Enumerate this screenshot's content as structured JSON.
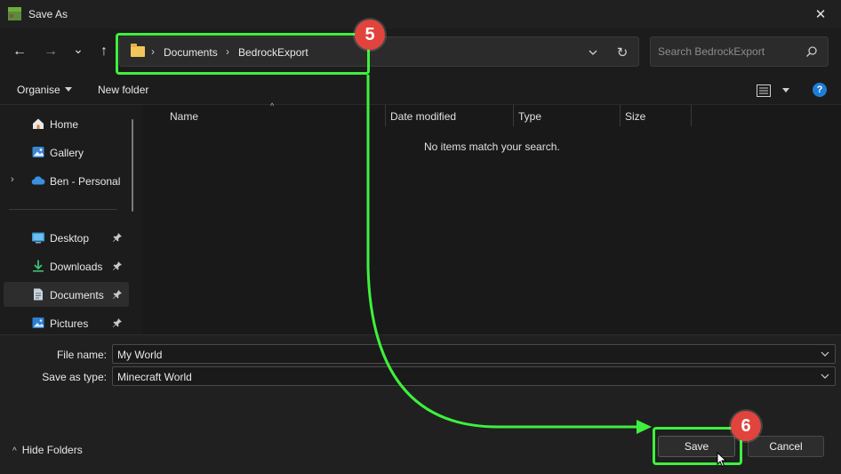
{
  "window": {
    "title": "Save As",
    "close_glyph": "✕"
  },
  "nav": {
    "back_glyph": "←",
    "forward_glyph": "→",
    "recent_glyph": "⌄",
    "up_glyph": "↑",
    "breadcrumb": [
      "Documents",
      "BedrockExport"
    ],
    "crumb_sep": "›",
    "refresh_glyph": "↻",
    "search_placeholder": "Search BedrockExport"
  },
  "toolbar": {
    "organise_label": "Organise",
    "new_folder_label": "New folder",
    "help_glyph": "?"
  },
  "sidebar": {
    "items": [
      {
        "label": "Home",
        "icon": "home-icon",
        "pinned": false
      },
      {
        "label": "Gallery",
        "icon": "gallery-icon",
        "pinned": false
      },
      {
        "label": "Ben - Personal",
        "icon": "onedrive-icon",
        "pinned": false,
        "expandable": true
      },
      {
        "label": "Desktop",
        "icon": "desktop-icon",
        "pinned": true
      },
      {
        "label": "Downloads",
        "icon": "downloads-icon",
        "pinned": true
      },
      {
        "label": "Documents",
        "icon": "documents-icon",
        "pinned": true,
        "selected": true
      },
      {
        "label": "Pictures",
        "icon": "pictures-icon",
        "pinned": true
      }
    ],
    "expand_glyph": "›"
  },
  "filepane": {
    "columns": [
      "Name",
      "Date modified",
      "Type",
      "Size"
    ],
    "sort_glyph": "^",
    "empty_message": "No items match your search."
  },
  "form": {
    "file_name_label": "File name:",
    "file_name_value": "My World",
    "save_type_label": "Save as type:",
    "save_type_value": "Minecraft World"
  },
  "footer": {
    "hide_folders_label": "Hide Folders",
    "hide_folders_glyph": "^",
    "save_label": "Save",
    "cancel_label": "Cancel"
  },
  "annotations": {
    "step_a": "5",
    "step_b": "6",
    "highlight_color": "#3ef03e",
    "badge_color": "#e0443d"
  },
  "colors": {
    "accent": "#1f7dd6",
    "background": "#1c1c1c"
  }
}
